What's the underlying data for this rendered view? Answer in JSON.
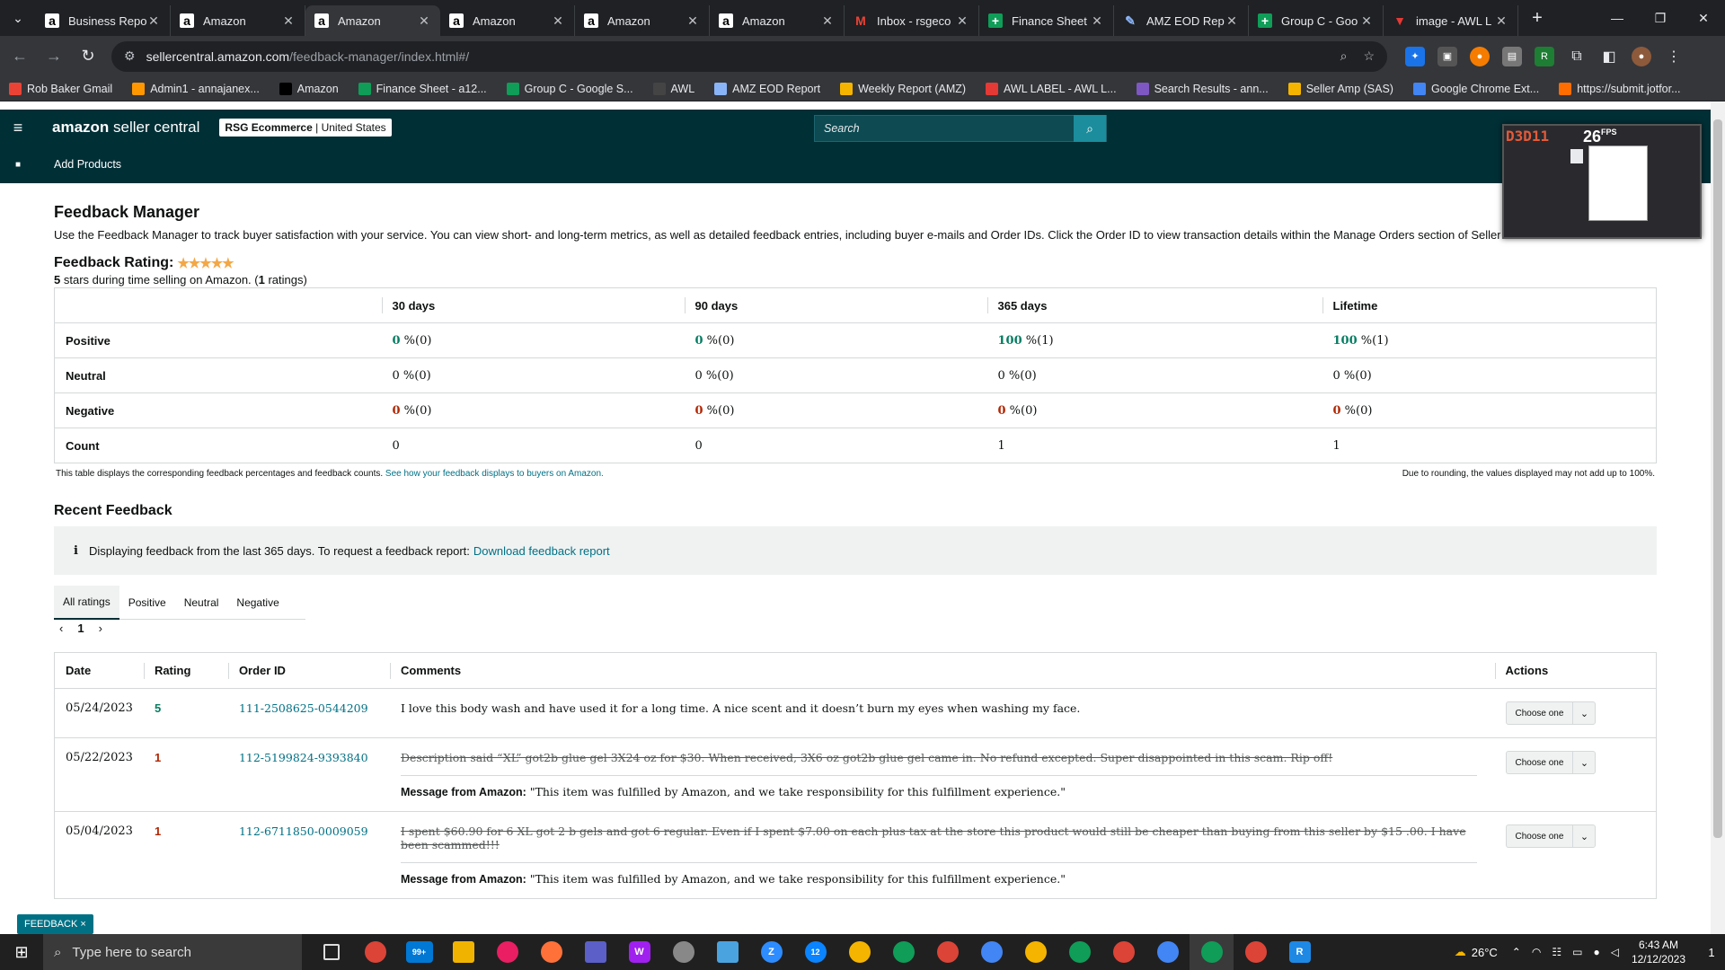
{
  "browser": {
    "tabs": [
      {
        "title": "Business Repo",
        "icon": "amazon-icon"
      },
      {
        "title": "Amazon",
        "icon": "amazon-icon"
      },
      {
        "title": "Amazon",
        "icon": "amazon-icon",
        "active": true
      },
      {
        "title": "Amazon",
        "icon": "amazon-icon"
      },
      {
        "title": "Amazon",
        "icon": "amazon-icon"
      },
      {
        "title": "Amazon",
        "icon": "amazon-icon"
      },
      {
        "title": "Inbox - rsgeco",
        "icon": "gmail-icon"
      },
      {
        "title": "Finance Sheet",
        "icon": "sheets-icon"
      },
      {
        "title": "AMZ EOD Repo",
        "icon": "pen-icon"
      },
      {
        "title": "Group C - Goo",
        "icon": "sheets-icon"
      },
      {
        "title": "image - AWL L",
        "icon": "awl-icon"
      }
    ],
    "url_host": "sellercentral.amazon.com",
    "url_path": "/feedback-manager/index.html#/",
    "bookmarks": [
      "Rob Baker Gmail",
      "Admin1 - annajanex...",
      "Amazon",
      "Finance Sheet - a12...",
      "Group C - Google S...",
      "AWL",
      "AMZ EOD Report",
      "Weekly Report (AMZ)",
      "AWL LABEL - AWL L...",
      "Search Results - ann...",
      "Seller Amp (SAS)",
      "Google Chrome Ext...",
      "https://submit.jotfor..."
    ]
  },
  "header": {
    "logo_bold": "amazon",
    "logo_light": " seller central",
    "account_name": "RSG Ecommerce",
    "account_region": " | United States",
    "search_placeholder": "Search",
    "add_products": "Add Products"
  },
  "overlay": {
    "label": "D3D11",
    "fps": "26",
    "fps_unit": "FPS"
  },
  "page": {
    "title": "Feedback Manager",
    "intro": "Use the Feedback Manager to track buyer satisfaction with your service. You can view short- and long-term metrics, as well as detailed feedback entries, including buyer e-mails and Order IDs. Click the Order ID to view transaction details within the Manage Orders section of Seller Central.",
    "rating_label": "Feedback Rating:",
    "rating_stars": "★★★★★",
    "rating_sub_stars": "5",
    "rating_sub_mid": " stars during time selling on Amazon. (",
    "rating_sub_count": "1",
    "rating_sub_end": " ratings)",
    "columns": [
      "30 days",
      "90 days",
      "365 days",
      "Lifetime"
    ],
    "rows": {
      "positive": {
        "label": "Positive",
        "values": [
          [
            "0",
            " %(0)"
          ],
          [
            "0",
            " %(0)"
          ],
          [
            "100",
            " %(1)"
          ],
          [
            "100",
            " %(1)"
          ]
        ]
      },
      "neutral": {
        "label": "Neutral",
        "values": [
          "0 %(0)",
          "0 %(0)",
          "0 %(0)",
          "0 %(0)"
        ]
      },
      "negative": {
        "label": "Negative",
        "values": [
          [
            "0",
            " %(0)"
          ],
          [
            "0",
            " %(0)"
          ],
          [
            "0",
            " %(0)"
          ],
          [
            "0",
            " %(0)"
          ]
        ]
      },
      "count": {
        "label": "Count",
        "values": [
          "0",
          "0",
          "1",
          "1"
        ]
      }
    },
    "table_note": "This table displays the corresponding feedback percentages and feedback counts. ",
    "table_note_link": "See how your feedback displays to buyers on Amazon.",
    "table_note_right": "Due to rounding, the values displayed may not add up to 100%.",
    "recent_title": "Recent Feedback",
    "info_text": "Displaying feedback from the last 365 days. To request a feedback report:",
    "info_link": "Download feedback report",
    "filter_tabs": [
      "All ratings",
      "Positive",
      "Neutral",
      "Negative"
    ],
    "page_number": "1",
    "feedback_columns": [
      "Date",
      "Rating",
      "Order ID",
      "Comments",
      "Actions"
    ],
    "feedback": [
      {
        "date": "05/24/2023",
        "rating": "5",
        "order_id": "111-2508625-0544209",
        "comment": "I love this body wash and have used it for a long time. A nice scent and it doesn’t burn my eyes when washing my face.",
        "struck": false,
        "action": "Choose one"
      },
      {
        "date": "05/22/2023",
        "rating": "1",
        "order_id": "112-5199824-9393840",
        "comment": "Description said “XL” got2b glue gel 3X24 oz for $30. When received, 3X6 oz got2b glue gel came in. No refund excepted. Super disappointed in this scam. Rip off!",
        "struck": true,
        "msg_label": "Message from Amazon:",
        "msg": " \"This item was fulfilled by Amazon, and we take responsibility for this fulfillment experience.\"",
        "action": "Choose one"
      },
      {
        "date": "05/04/2023",
        "rating": "1",
        "order_id": "112-6711850-0009059",
        "comment": "I spent $60.90 for 6 XL got 2 b gels and got 6 regular. Even if I spent $7.00 on each plus tax at the store this product would still be cheaper than buying from this seller by $15 .00. I have been scammed!!!",
        "struck": true,
        "msg_label": "Message from Amazon:",
        "msg": " \"This item was fulfilled by Amazon, and we take responsibility for this fulfillment experience.\"",
        "action": "Choose one"
      }
    ],
    "feedback_tag": "FEEDBACK ×"
  },
  "taskbar": {
    "search_placeholder": "Type here to search",
    "mail_badge": "99+",
    "badge_12": "12",
    "temperature": "26°C",
    "time": "6:43 AM",
    "date": "12/12/2023",
    "notif_count": "1"
  }
}
